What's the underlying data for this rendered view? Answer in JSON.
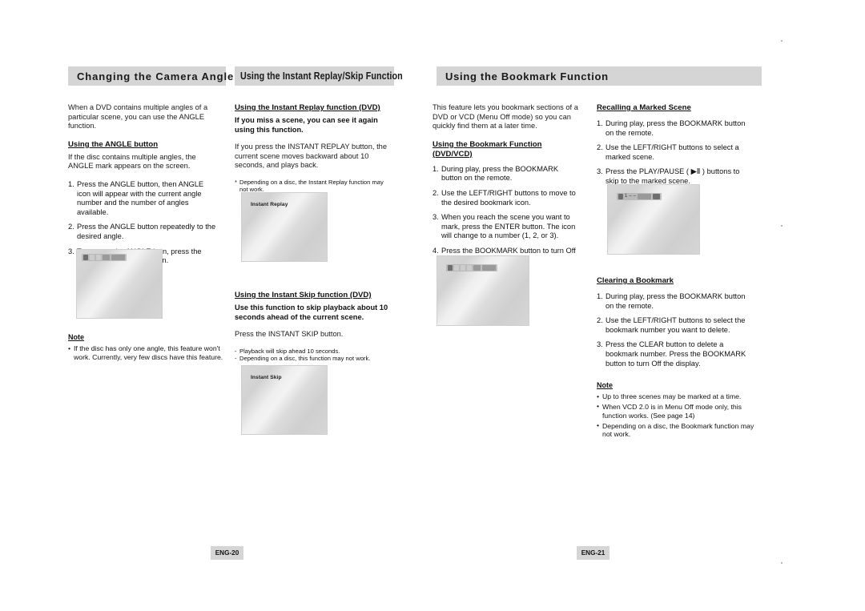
{
  "document": {
    "kind": "dvd-player-user-manual-spread",
    "left_page_tag": "ENG-20",
    "right_page_tag": "ENG-21"
  },
  "headers": {
    "angle": "Changing the Camera Angle",
    "replay_skip": "Using the Instant Replay/Skip Function",
    "bookmark": "Using the Bookmark Function"
  },
  "angle_section": {
    "intro": "When a DVD contains multiple angles of a particular scene, you can use the ANGLE function.",
    "sub_head": "Using the ANGLE button",
    "sub_intro": "If the disc contains multiple angles, the ANGLE mark appears on the screen.",
    "steps": [
      {
        "n": "1.",
        "text": "Press the ANGLE button, then ANGLE icon will appear with the current angle number and the number of angles available."
      },
      {
        "n": "2.",
        "text": "Press the ANGLE button repeatedly to the desired angle."
      },
      {
        "n": "3.",
        "text": "To remove the ANGLE icon, press the CLEAR or RETURN button."
      }
    ],
    "note_head": "Note",
    "notes": [
      "If the disc has only one angle, this feature won't work. Currently, very few discs have this feature."
    ]
  },
  "replay_section": {
    "sub_head": "Using the Instant Replay function (DVD)",
    "lead": "If you miss a scene, you can see it again using this function.",
    "body": "If you press the INSTANT REPLAY button, the current scene moves backward about 10 seconds, and plays back.",
    "footnote_marker": "*",
    "footnote": "Depending on a disc, the Instant Replay function may not work.",
    "screen_label": "Instant Replay"
  },
  "skip_section": {
    "sub_head": "Using the Instant Skip function (DVD)",
    "lead": "Use this function to skip playback about 10 seconds ahead of the current scene.",
    "body": "Press the INSTANT SKIP button.",
    "fine_notes": [
      "Playback will skip ahead 10 seconds.",
      "Depending on a disc, this function may not work."
    ],
    "screen_label": "Instant Skip"
  },
  "bookmark_section": {
    "intro": "This feature lets you bookmark sections of a DVD or VCD (Menu Off mode) so you can quickly find them at a later time.",
    "sub_head": "Using the Bookmark Function (DVD/VCD)",
    "steps": [
      {
        "n": "1.",
        "text": "During play, press the BOOKMARK button on the remote."
      },
      {
        "n": "2.",
        "text": "Use the LEFT/RIGHT buttons to move to the desired bookmark icon."
      },
      {
        "n": "3.",
        "text": "When you reach the scene you want to mark, press the ENTER button. The icon will change to a number (1, 2, or 3)."
      },
      {
        "n": "4.",
        "text": "Press the BOOKMARK button to turn Off the display."
      }
    ]
  },
  "recall_section": {
    "sub_head": "Recalling a Marked Scene",
    "steps": [
      {
        "n": "1.",
        "text": "During play, press the BOOKMARK button on the remote."
      },
      {
        "n": "2.",
        "text": "Use the LEFT/RIGHT buttons to select a marked scene."
      },
      {
        "n": "3.",
        "text": "Press the PLAY/PAUSE ( ▶Ⅱ ) buttons to skip to the marked scene."
      }
    ],
    "play_pause_glyph": "▶Ⅱ"
  },
  "clearing_section": {
    "sub_head": "Clearing a Bookmark",
    "steps": [
      {
        "n": "1.",
        "text": "During play, press the BOOKMARK button on the remote."
      },
      {
        "n": "2.",
        "text": "Use the LEFT/RIGHT buttons to select the bookmark number you want to delete."
      },
      {
        "n": "3.",
        "text": "Press the CLEAR button to delete a bookmark number. Press the BOOKMARK button to turn Off the display."
      }
    ],
    "note_head": "Note",
    "notes": [
      "Up to three scenes may be marked at a time.",
      "When VCD 2.0 is in Menu Off mode only, this function works. (See page 14)",
      "Depending on a disc, the Bookmark function may not work."
    ]
  },
  "osd": {
    "bookmark_number": "1",
    "dash": "–",
    "dash2": "–"
  },
  "colors": {
    "header_bar": "#d5d5d5",
    "page_tag": "#d5d5d5",
    "text": "#111111",
    "screen_gray": "#d9d9d9"
  }
}
